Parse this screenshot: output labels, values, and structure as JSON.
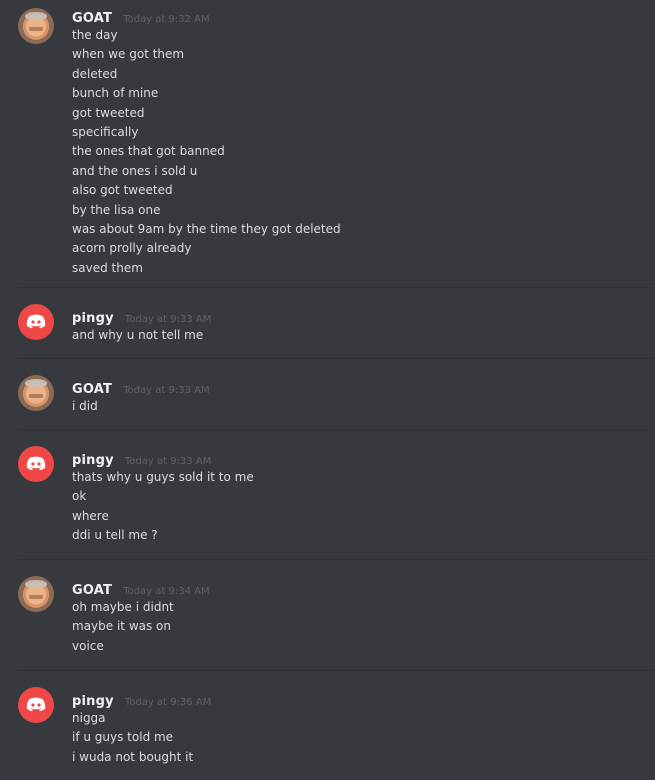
{
  "messages": [
    {
      "author": "GOAT",
      "timestamp": "Today at 9:32 AM",
      "avatar": "goat-avatar",
      "lines": [
        "the day",
        "when we got them",
        "deleted",
        "bunch of mine",
        "got tweeted",
        "specifically",
        "the ones that got banned",
        "and the ones i sold u",
        "also got tweeted",
        "by the lisa one",
        "was about 9am by the time they got deleted",
        "acorn prolly already",
        "saved them"
      ]
    },
    {
      "author": "pingy",
      "timestamp": "Today at 9:33 AM",
      "avatar": "discord-avatar",
      "lines": [
        "and why u not tell me"
      ]
    },
    {
      "author": "GOAT",
      "timestamp": "Today at 9:33 AM",
      "avatar": "goat-avatar",
      "lines": [
        "i did"
      ]
    },
    {
      "author": "pingy",
      "timestamp": "Today at 9:33 AM",
      "avatar": "discord-avatar",
      "lines": [
        "thats why u guys sold it to me",
        "ok",
        "where",
        "ddi u tell me ?"
      ]
    },
    {
      "author": "GOAT",
      "timestamp": "Today at 9:34 AM",
      "avatar": "goat-avatar",
      "lines": [
        "oh maybe i didnt",
        "maybe it was on",
        "voice"
      ]
    },
    {
      "author": "pingy",
      "timestamp": "Today at 9:36 AM",
      "avatar": "discord-avatar",
      "lines": [
        "nigga",
        "if u guys told me",
        "i wuda not bought it"
      ]
    }
  ],
  "colors": {
    "background": "#36393e",
    "text": "#dcddde",
    "author": "#f1f2f3",
    "timestamp": "#5e6168",
    "discord_avatar": "#f04747",
    "divider": "#2f3136"
  }
}
